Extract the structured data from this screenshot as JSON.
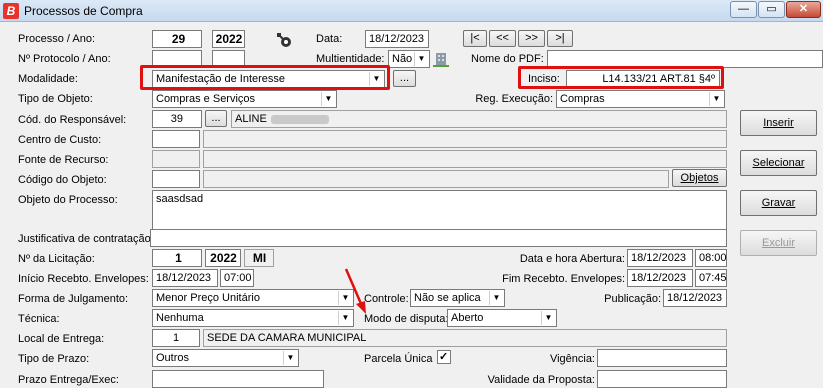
{
  "window": {
    "title": "Processos de Compra",
    "logo": "B",
    "min": "—",
    "max": "▭",
    "close": "✕"
  },
  "labels": {
    "processo_ano": "Processo / Ano:",
    "protocolo_ano": "Nº Protocolo / Ano:",
    "modalidade": "Modalidade:",
    "tipo_objeto": "Tipo de Objeto:",
    "cod_responsavel": "Cód. do Responsável:",
    "centro_custo": "Centro de Custo:",
    "fonte_recurso": "Fonte de Recurso:",
    "codigo_objeto": "Código do Objeto:",
    "objeto_processo": "Objeto do Processo:",
    "justificativa": "Justificativa de contratação:",
    "num_licitacao": "Nº da Licitação:",
    "inicio_recebimento": "Início Recebto. Envelopes:",
    "forma_julgamento": "Forma de Julgamento:",
    "tecnica": "Técnica:",
    "local_entrega": "Local de Entrega:",
    "tipo_prazo": "Tipo de Prazo:",
    "prazo_entrega": "Prazo Entrega/Exec:",
    "data": "Data:",
    "multientidade": "Multientidade:",
    "nome_pdf": "Nome do PDF:",
    "inciso": "Inciso:",
    "reg_execucao": "Reg. Execução:",
    "data_hora_abertura": "Data e hora Abertura:",
    "fim_recebimento": "Fim Recebto. Envelopes:",
    "controle": "Controle:",
    "publicacao": "Publicação:",
    "modo_disputa": "Modo de disputa:",
    "parcela_unica": "Parcela Única",
    "vigencia": "Vigência:",
    "validade_proposta": "Validade da Proposta:"
  },
  "values": {
    "processo": "29",
    "ano": "2022",
    "data": "18/12/2023",
    "multientidade": "Não",
    "modalidade": "Manifestação de Interesse",
    "inciso": "L14.133/21 ART.81 §4º",
    "tipo_objeto": "Compras e Serviços",
    "reg_execucao": "Compras",
    "cod_responsavel": "39",
    "nome_responsavel": "ALINE",
    "objeto_processo": "saasdsad",
    "num_licitacao": "1",
    "ano_licitacao": "2022",
    "sigla_licitacao": "MI",
    "data_abertura": "18/12/2023",
    "hora_abertura": "08:00",
    "inicio_data": "18/12/2023",
    "inicio_hora": "07:00",
    "fim_data": "18/12/2023",
    "fim_hora": "07:45",
    "forma_julgamento": "Menor Preço Unitário",
    "controle": "Não se aplica",
    "publicacao": "18/12/2023",
    "tecnica": "Nenhuma",
    "modo_disputa": "Aberto",
    "local_entrega_cod": "1",
    "local_entrega_nome": "SEDE DA CAMARA MUNICIPAL",
    "tipo_prazo": "Outros",
    "parcela_unica_checked": "✓"
  },
  "nav": {
    "first": "|<",
    "prev": "<<",
    "next": ">>",
    "last": ">|"
  },
  "buttons": {
    "inserir": "Inserir",
    "selecionar": "Selecionar",
    "gravar": "Gravar",
    "excluir": "Excluir",
    "objetos": "Objetos",
    "ellipsis": "..."
  },
  "colors": {
    "highlight": "#e01010",
    "arrow": "#e01010"
  }
}
